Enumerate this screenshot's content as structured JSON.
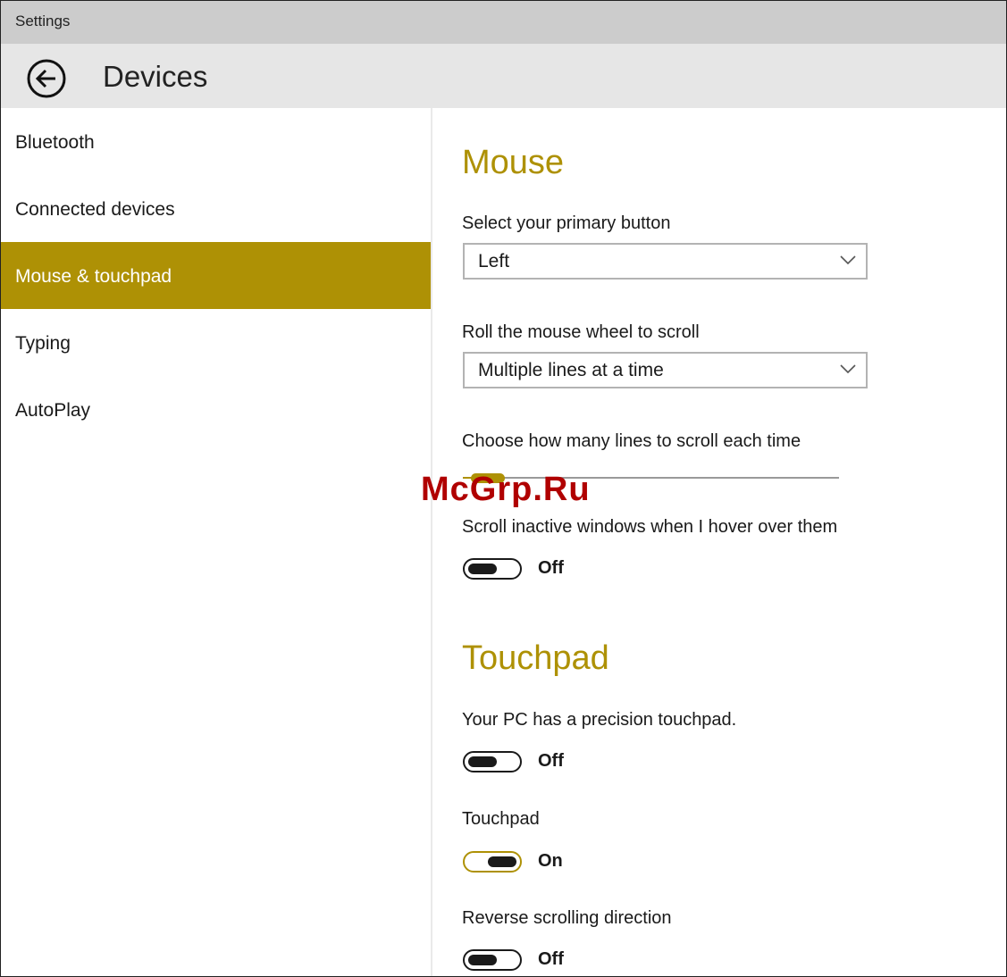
{
  "window": {
    "title": "Settings"
  },
  "header": {
    "page_title": "Devices"
  },
  "sidebar": {
    "items": [
      {
        "label": "Bluetooth",
        "active": false
      },
      {
        "label": "Connected devices",
        "active": false
      },
      {
        "label": "Mouse & touchpad",
        "active": true
      },
      {
        "label": "Typing",
        "active": false
      },
      {
        "label": "AutoPlay",
        "active": false
      }
    ]
  },
  "mouse": {
    "section_title": "Mouse",
    "primary_button_label": "Select your primary button",
    "primary_button_value": "Left",
    "wheel_label": "Roll the mouse wheel to scroll",
    "wheel_value": "Multiple lines at a time",
    "lines_label": "Choose how many lines to scroll each time",
    "lines_slider_fraction": 0.03,
    "inactive_label": "Scroll inactive windows when I hover over them",
    "inactive_state": "Off"
  },
  "touchpad": {
    "section_title": "Touchpad",
    "precision_label": "Your PC has a precision touchpad.",
    "precision_state": "Off",
    "touchpad_label": "Touchpad",
    "touchpad_state": "On",
    "reverse_label": "Reverse scrolling direction",
    "reverse_state": "Off"
  },
  "watermark": "McGrp.Ru",
  "colors": {
    "accent": "#ae9105",
    "titlebar": "#cccccc",
    "header": "#e6e6e6",
    "watermark": "#b00000"
  }
}
